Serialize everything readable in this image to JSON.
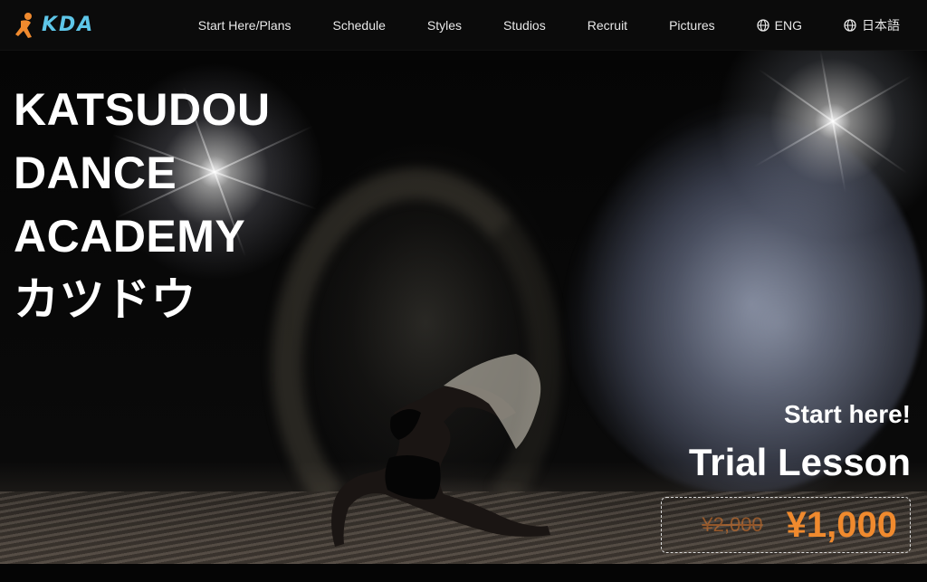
{
  "brand": {
    "logo_text": "KDA",
    "logo_color": "#5ec6e8",
    "logo_mark_color": "#f08a2e"
  },
  "nav": {
    "items": [
      {
        "label": "Start Here/Plans"
      },
      {
        "label": "Schedule"
      },
      {
        "label": "Styles"
      },
      {
        "label": "Studios"
      },
      {
        "label": "Recruit"
      },
      {
        "label": "Pictures"
      }
    ],
    "lang_en": "ENG",
    "lang_ja": "日本語",
    "lang_icon": "globe-icon"
  },
  "hero": {
    "title_lines": [
      "KATSUDOU",
      "DANCE",
      "ACADEMY",
      "カツドウ"
    ]
  },
  "cta": {
    "subtitle": "Start here!",
    "title": "Trial Lesson",
    "price_old": "¥2,000",
    "price_new": "¥1,000",
    "accent_color": "#f08a2e"
  }
}
